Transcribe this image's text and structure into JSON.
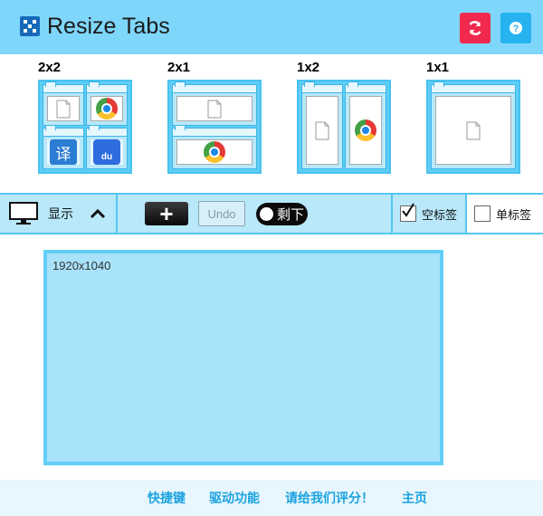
{
  "header": {
    "title": "Resize Tabs",
    "logo_icon": "resize-app-logo",
    "refresh_icon": "refresh-icon",
    "help_icon": "help-icon",
    "refresh_color": "#f0294e",
    "help_color": "#26b3f0",
    "background": "#7fd6fb"
  },
  "layouts": [
    {
      "label": "2x2",
      "tiles": [
        "blank-page-icon",
        "chrome-icon",
        "translate-icon",
        "baidu-icon"
      ]
    },
    {
      "label": "2x1",
      "tiles": [
        "blank-page-icon",
        "chrome-icon"
      ]
    },
    {
      "label": "1x2",
      "tiles": [
        "blank-page-icon",
        "chrome-icon"
      ]
    },
    {
      "label": "1x1",
      "tiles": [
        "blank-page-icon"
      ]
    }
  ],
  "tile_text": {
    "translate": "译",
    "baidu": "du"
  },
  "toolbar": {
    "display_label": "显示",
    "add_label": "+",
    "undo_label": "Undo",
    "remaining_label": "剩下",
    "empty_tab_label": "空标签",
    "empty_tab_checked": true,
    "single_tab_label": "单标签",
    "single_tab_checked": false
  },
  "preview": {
    "resolution": "1920x1040"
  },
  "footer": {
    "links": [
      "快捷键",
      "驱动功能",
      "请给我们评分！",
      "主页"
    ],
    "link_color": "#1ca3e0"
  }
}
